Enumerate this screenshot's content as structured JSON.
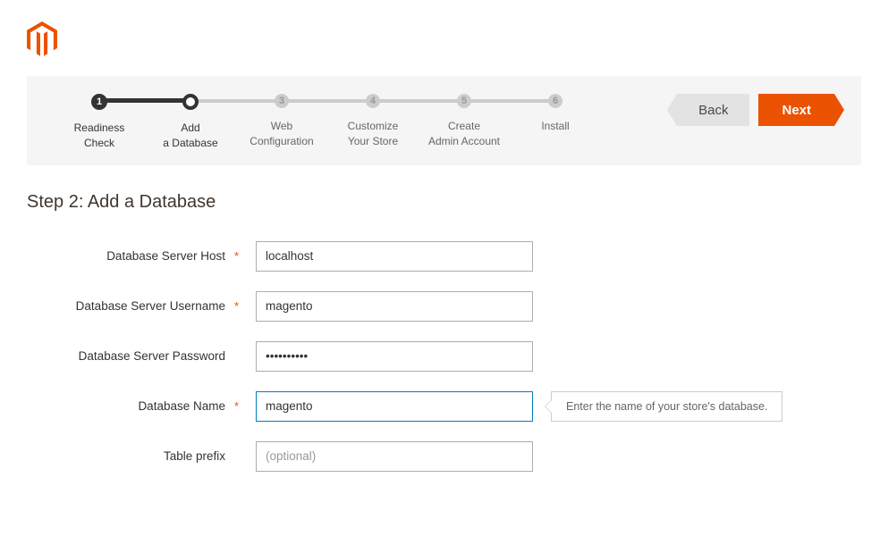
{
  "nav": {
    "back_label": "Back",
    "next_label": "Next"
  },
  "steps": [
    {
      "num": "1",
      "label": "Readiness\nCheck"
    },
    {
      "num": "",
      "label": "Add\na Database"
    },
    {
      "num": "3",
      "label": "Web\nConfiguration"
    },
    {
      "num": "4",
      "label": "Customize\nYour Store"
    },
    {
      "num": "5",
      "label": "Create\nAdmin Account"
    },
    {
      "num": "6",
      "label": "Install"
    }
  ],
  "page": {
    "title": "Step 2: Add a Database"
  },
  "form": {
    "host": {
      "label": "Database Server Host",
      "value": "localhost",
      "required": true
    },
    "username": {
      "label": "Database Server Username",
      "value": "magento",
      "required": true
    },
    "password": {
      "label": "Database Server Password",
      "value": "••••••••••",
      "required": false
    },
    "dbname": {
      "label": "Database Name",
      "value": "magento",
      "required": true,
      "tooltip": "Enter the name of your store's database."
    },
    "prefix": {
      "label": "Table prefix",
      "value": "",
      "placeholder": "(optional)",
      "required": false
    }
  }
}
